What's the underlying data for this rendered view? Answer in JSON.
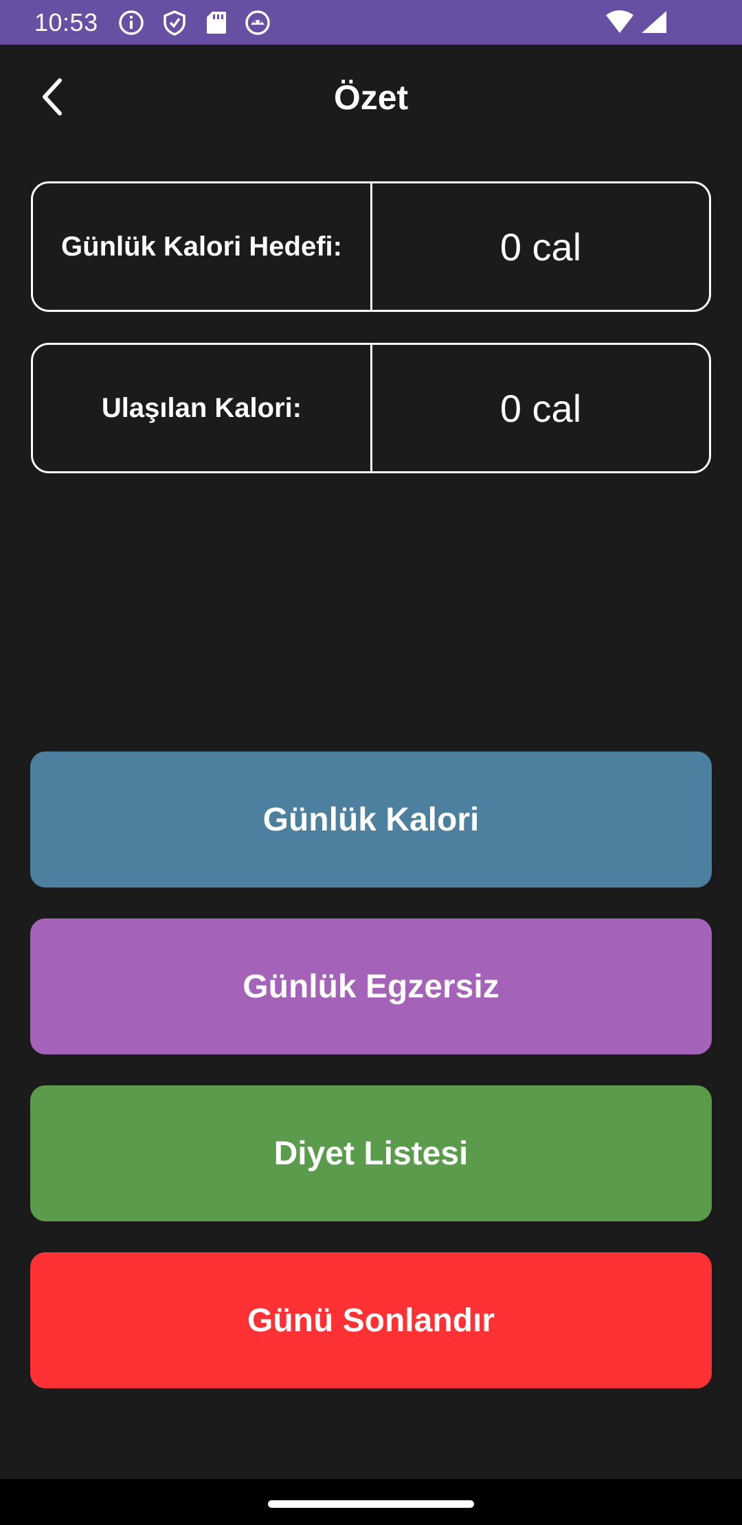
{
  "status_bar": {
    "time": "10:53",
    "icons": [
      "info-icon",
      "shield-icon",
      "sd-card-icon",
      "android-debug-icon",
      "wifi-icon",
      "signal-icon"
    ],
    "background": "#6750a4"
  },
  "app_bar": {
    "title": "Özet",
    "back_icon": "chevron-left-icon"
  },
  "summary": {
    "goal_label": "Günlük Kalori Hedefi:",
    "goal_value": "0 cal",
    "achieved_label": "Ulaşılan Kalori:",
    "achieved_value": "0 cal"
  },
  "buttons": {
    "daily_calorie": {
      "label": "Günlük Kalori",
      "color": "#4d7f9e"
    },
    "daily_exercise": {
      "label": "Günlük Egzersiz",
      "color": "#a463b8"
    },
    "diet_list": {
      "label": "Diyet Listesi",
      "color": "#5a9c4b"
    },
    "end_day": {
      "label": "Günü Sonlandır",
      "color": "#fe3235"
    }
  },
  "colors": {
    "background": "#1b1b1b",
    "text": "#ffffff",
    "nav_bar": "#000000"
  }
}
